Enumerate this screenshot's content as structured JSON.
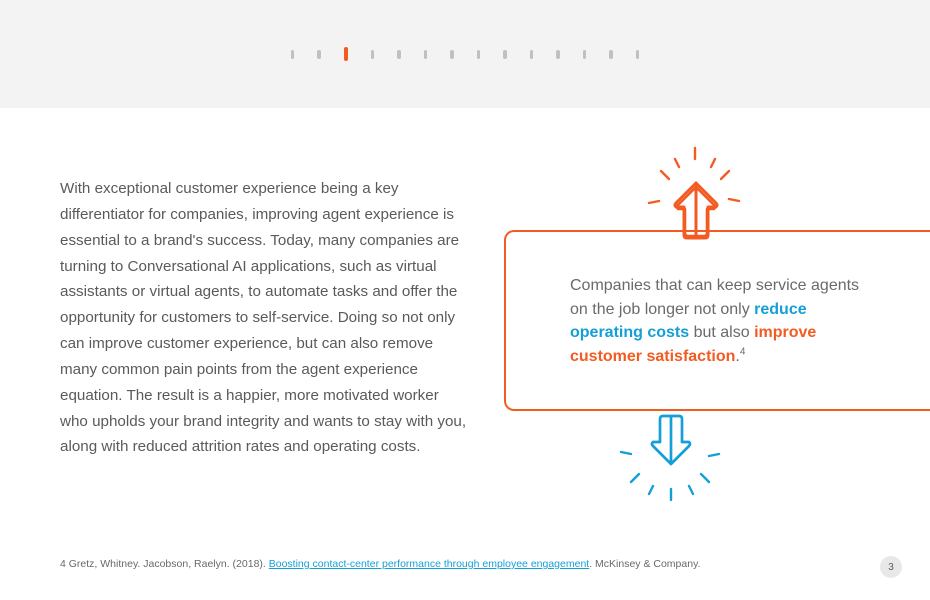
{
  "pagination": {
    "total": 14,
    "current_index": 2
  },
  "body_text": "With exceptional customer experience being a key differentiator for companies, improving agent experience is essential to a brand's success. Today, many companies are turning to Conversational AI applications, such as virtual assistants or virtual agents, to automate tasks and offer the opportunity for customers to self-service. Doing so not only can improve customer experience, but can also remove many common pain points from the agent experience equation. The result is a happier, more motivated worker who upholds your brand integrity and wants to stay with you, along with reduced attrition rates and operating costs.",
  "callout": {
    "before": "Companies that can keep service agents on the job longer not only ",
    "highlight_blue": "reduce operating costs",
    "mid": " but also ",
    "highlight_orange": "improve customer satisfaction",
    "after": ".",
    "footnote_ref": "4"
  },
  "footnote": {
    "number": "4",
    "authors": " Gretz, Whitney. Jacobson, Raelyn. (2018). ",
    "link_text": "Boosting contact-center performance through employee engagement",
    "suffix": ". McKinsey & Company."
  },
  "page_number": "3",
  "colors": {
    "accent_orange": "#f25c22",
    "accent_blue": "#159fd7"
  }
}
